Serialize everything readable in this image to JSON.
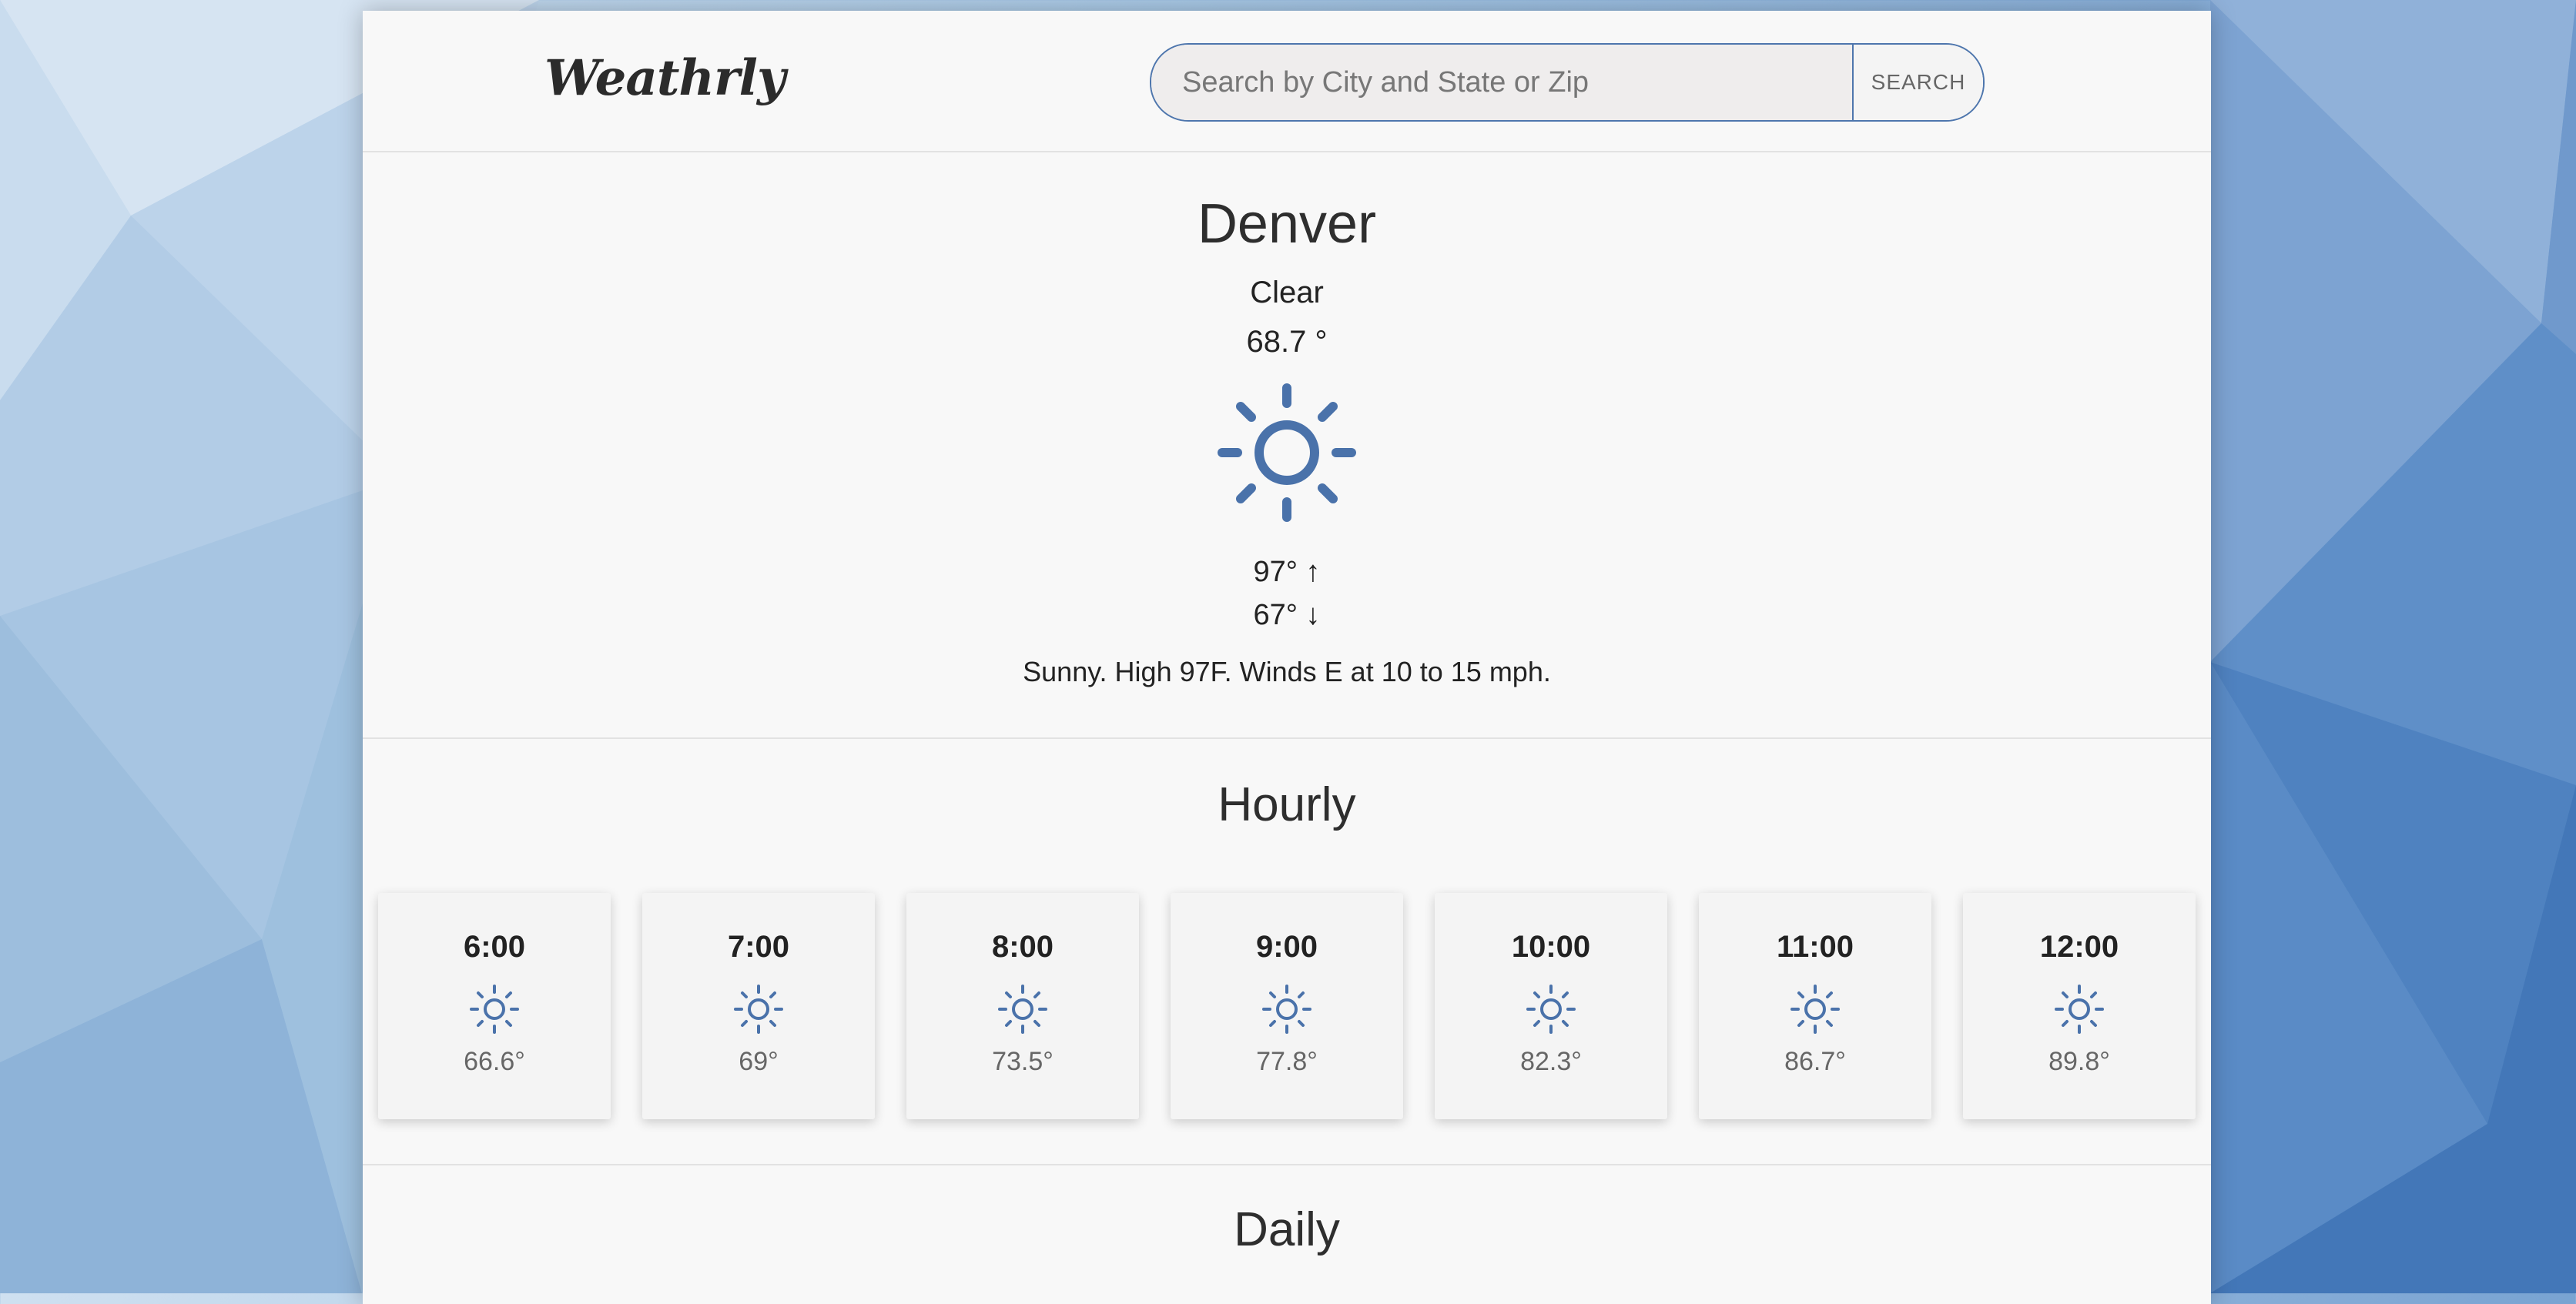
{
  "app": {
    "logo": "Weathrly"
  },
  "search": {
    "placeholder": "Search by City and State or Zip",
    "button_label": "SEARCH"
  },
  "current": {
    "city": "Denver",
    "condition": "Clear",
    "temperature": "68.7 °",
    "icon": "sun-icon",
    "high": "97° ↑",
    "low": "67° ↓",
    "summary": "Sunny. High 97F. Winds E at 10 to 15 mph."
  },
  "hourly": {
    "title": "Hourly",
    "items": [
      {
        "time": "6:00",
        "icon": "sun-icon",
        "temp": "66.6°"
      },
      {
        "time": "7:00",
        "icon": "sun-icon",
        "temp": "69°"
      },
      {
        "time": "8:00",
        "icon": "sun-icon",
        "temp": "73.5°"
      },
      {
        "time": "9:00",
        "icon": "sun-icon",
        "temp": "77.8°"
      },
      {
        "time": "10:00",
        "icon": "sun-icon",
        "temp": "82.3°"
      },
      {
        "time": "11:00",
        "icon": "sun-icon",
        "temp": "86.7°"
      },
      {
        "time": "12:00",
        "icon": "sun-icon",
        "temp": "89.8°"
      }
    ]
  },
  "daily": {
    "title": "Daily"
  },
  "colors": {
    "accent": "#4a72aa",
    "panel": "#f8f8f8"
  }
}
